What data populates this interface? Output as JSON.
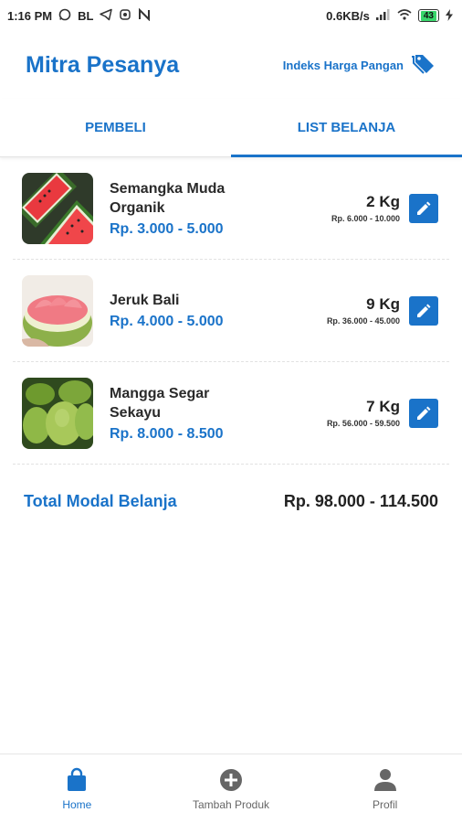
{
  "status_bar": {
    "time": "1:16 PM",
    "carrier_label": "BL",
    "net_speed": "0.6KB/s",
    "battery": "43",
    "icons": [
      "whatsapp-icon",
      "telegram-icon",
      "app-icon",
      "n-icon",
      "signal-icon",
      "wifi-icon",
      "battery-icon",
      "charging-icon"
    ]
  },
  "header": {
    "title": "Mitra Pesanya",
    "price_index_label": "Indeks Harga Pangan",
    "price_index_icon": "tags-icon"
  },
  "tabs": [
    {
      "label": "PEMBELI",
      "active": false
    },
    {
      "label": "LIST BELANJA",
      "active": true
    }
  ],
  "items": [
    {
      "name_line1": "Semangka Muda",
      "name_line2": "Organik",
      "price": "Rp. 3.000 - 5.000",
      "qty": "2 Kg",
      "qty_range": "Rp. 6.000 - 10.000",
      "image": "watermelon-image"
    },
    {
      "name_line1": "Jeruk Bali",
      "name_line2": "",
      "price": "Rp. 4.000 - 5.000",
      "qty": "9 Kg",
      "qty_range": "Rp. 36.000 - 45.000",
      "image": "pomelo-image"
    },
    {
      "name_line1": "Mangga Segar",
      "name_line2": "Sekayu",
      "price": "Rp. 8.000 - 8.500",
      "qty": "7 Kg",
      "qty_range": "Rp. 56.000 - 59.500",
      "image": "mango-image"
    }
  ],
  "total": {
    "label": "Total Modal Belanja",
    "value": "Rp. 98.000 - 114.500"
  },
  "bottom_nav": [
    {
      "label": "Home",
      "icon": "shopping-bag-icon",
      "active": true
    },
    {
      "label": "Tambah Produk",
      "icon": "add-circle-icon",
      "active": false
    },
    {
      "label": "Profil",
      "icon": "person-icon",
      "active": false
    }
  ],
  "colors": {
    "accent": "#1a73c9",
    "text": "#222222",
    "battery_fill": "#38d66b"
  }
}
